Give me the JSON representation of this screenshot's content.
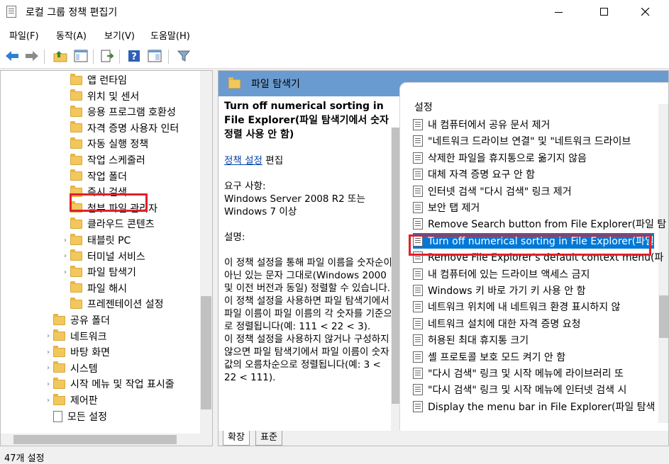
{
  "window": {
    "title": "로컬 그룹 정책 편집기"
  },
  "menu": [
    "파일(F)",
    "동작(A)",
    "보기(V)",
    "도움말(H)"
  ],
  "tree": [
    {
      "label": "앱 런타임",
      "indent": 1,
      "arrow": ""
    },
    {
      "label": "위치 및 센서",
      "indent": 1,
      "arrow": ""
    },
    {
      "label": "응용 프로그램 호환성",
      "indent": 1,
      "arrow": ""
    },
    {
      "label": "자격 증명 사용자 인터",
      "indent": 1,
      "arrow": ""
    },
    {
      "label": "자동 실행 정책",
      "indent": 1,
      "arrow": ""
    },
    {
      "label": "작업 스케줄러",
      "indent": 1,
      "arrow": ""
    },
    {
      "label": "작업 폴더",
      "indent": 1,
      "arrow": ""
    },
    {
      "label": "즉시 검색",
      "indent": 1,
      "arrow": ""
    },
    {
      "label": "첨부 파일 관리자",
      "indent": 1,
      "arrow": ""
    },
    {
      "label": "클라우드 콘텐츠",
      "indent": 1,
      "arrow": ""
    },
    {
      "label": "태블릿 PC",
      "indent": 1,
      "arrow": ">"
    },
    {
      "label": "터미널 서비스",
      "indent": 1,
      "arrow": ">"
    },
    {
      "label": "파일 탐색기",
      "indent": 1,
      "arrow": ">"
    },
    {
      "label": "파일 해시",
      "indent": 1,
      "arrow": ""
    },
    {
      "label": "프레젠테이션 설정",
      "indent": 1,
      "arrow": ""
    },
    {
      "label": "공유 폴더",
      "indent": 0,
      "arrow": ""
    },
    {
      "label": "네트워크",
      "indent": 0,
      "arrow": ">"
    },
    {
      "label": "바탕 화면",
      "indent": 0,
      "arrow": ">"
    },
    {
      "label": "시스템",
      "indent": 0,
      "arrow": ">"
    },
    {
      "label": "시작 메뉴 및 작업 표시줄",
      "indent": 0,
      "arrow": ">"
    },
    {
      "label": "제어판",
      "indent": 0,
      "arrow": ">"
    },
    {
      "label": "모든 설정",
      "indent": 0,
      "arrow": "",
      "icon": "doc"
    }
  ],
  "header": {
    "title": "파일 탐색기"
  },
  "description": {
    "title": "Turn off numerical sorting in File Explorer(파일 탐색기에서 숫자 정렬 사용 안 함)",
    "link": "정책 설정",
    "edit": " 편집",
    "req_label": "요구 사항:",
    "req_text": "Windows Server 2008 R2 또는 Windows 7 이상",
    "desc_label": "설명:",
    "desc_text": "이 정책 설정을 통해 파일 이름을 숫자순이 아닌 있는 문자 그대로(Windows 2000 및 이전 버전과 동일) 정렬할 수 있습니다.",
    "desc_text2": "이 정책 설정을 사용하면 파일 탐색기에서 파일 이름이 파일 이름의 각 숫자를 기준으로 정렬됩니다(예: 111 < 22 < 3).",
    "desc_text3": "이 정책 설정을 사용하지 않거나 구성하지 않으면 파일 탐색기에서 파일 이름이 숫자 값의 오름차순으로 정렬됩니다(예: 3 < 22 < 111)."
  },
  "list": {
    "header": "설정",
    "items": [
      "내 컴퓨터에서 공유 문서 제거",
      "\"네트워크 드라이브 연결\" 및 \"네트워크 드라이브",
      "삭제한 파일을 휴지통으로 옮기지 않음",
      "대체 자격 증명 요구 안 함",
      "인터넷 검색 \"다시 검색\" 링크 제거",
      "보안 탭 제거",
      "Remove Search button from File Explorer(파일 탐",
      "Turn off numerical sorting in File Explorer(파일",
      "Remove File Explorer's default context menu(파",
      "내 컴퓨터에 있는 드라이브 액세스 금지",
      "Windows 키 바로 가기 키 사용 안 함",
      "네트워크 위치에 내 네트워크 환경 표시하지 않",
      "네트워크 설치에 대한 자격 증명 요청",
      "허용된 최대 휴지통 크기",
      "셸 프로토콜 보호 모드 켜기 안 함",
      "\"다시 검색\" 링크 및 시작 메뉴에 라이브러리 또",
      "\"다시 검색\" 링크 및 시작 메뉴에 인터넷 검색 시",
      "Display the menu bar in File Explorer(파일 탐색"
    ],
    "selected_index": 7
  },
  "tabs": [
    "확장",
    "표준"
  ],
  "status": "47개 설정",
  "colors": {
    "header_band": "#6a9bd0",
    "selection": "#0078d7",
    "highlight_box": "#e0202a"
  }
}
